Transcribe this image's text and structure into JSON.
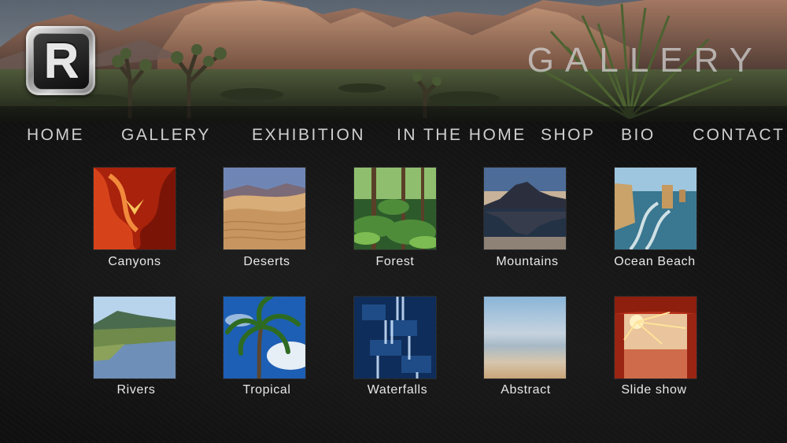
{
  "header": {
    "logo_letter": "R",
    "title": "GALLERY"
  },
  "nav": {
    "items": [
      {
        "label": "HOME"
      },
      {
        "label": "GALLERY"
      },
      {
        "label": "EXHIBITION"
      },
      {
        "label": "IN THE HOME"
      },
      {
        "label": "SHOP"
      },
      {
        "label": "BIO"
      },
      {
        "label": "CONTACT"
      }
    ]
  },
  "gallery": {
    "categories": [
      {
        "label": "Canyons",
        "thumb": "canyon-slot-image"
      },
      {
        "label": "Deserts",
        "thumb": "sand-dunes-image"
      },
      {
        "label": "Forest",
        "thumb": "fern-forest-image"
      },
      {
        "label": "Mountains",
        "thumb": "mountain-lake-image"
      },
      {
        "label": "Ocean Beach",
        "thumb": "sea-stacks-image"
      },
      {
        "label": "Rivers",
        "thumb": "river-valley-image"
      },
      {
        "label": "Tropical",
        "thumb": "palm-tree-image"
      },
      {
        "label": "Waterfalls",
        "thumb": "waterfall-image"
      },
      {
        "label": "Abstract",
        "thumb": "blurred-beach-image"
      },
      {
        "label": "Slide show",
        "thumb": "arch-sunburst-image"
      }
    ]
  },
  "colors": {
    "background": "#0e0e0e",
    "nav_text": "#cfcfcf",
    "caption_text": "#e8e8e8"
  }
}
